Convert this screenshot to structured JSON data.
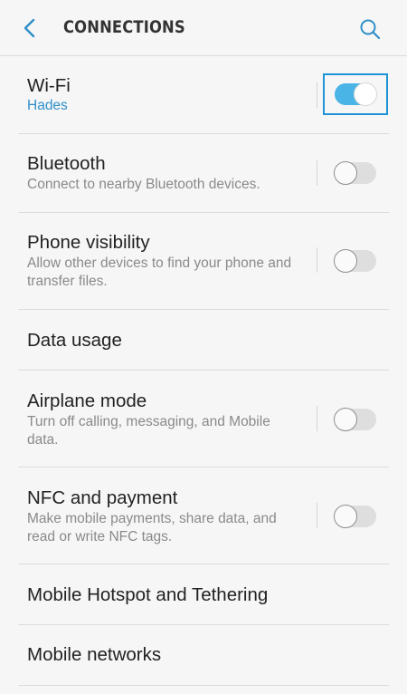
{
  "header": {
    "title": "CONNECTIONS",
    "back_icon": "chevron-left-icon",
    "search_icon": "search-icon"
  },
  "colors": {
    "accent": "#2f8fc8",
    "toggle_on": "#4ab4e6",
    "focus": "#1e94d6"
  },
  "items": [
    {
      "title": "Wi-Fi",
      "subtitle": "Hades",
      "toggle": true,
      "focused": true
    },
    {
      "title": "Bluetooth",
      "subtitle": "Connect to nearby Bluetooth devices.",
      "toggle": false
    },
    {
      "title": "Phone visibility",
      "subtitle": "Allow other devices to find your phone and transfer files.",
      "toggle": false
    },
    {
      "title": "Data usage"
    },
    {
      "title": "Airplane mode",
      "subtitle": "Turn off calling, messaging, and Mobile data.",
      "toggle": false
    },
    {
      "title": "NFC and payment",
      "subtitle": "Make mobile payments, share data, and read or write NFC tags.",
      "toggle": false
    },
    {
      "title": "Mobile Hotspot and Tethering"
    },
    {
      "title": "Mobile networks"
    }
  ]
}
